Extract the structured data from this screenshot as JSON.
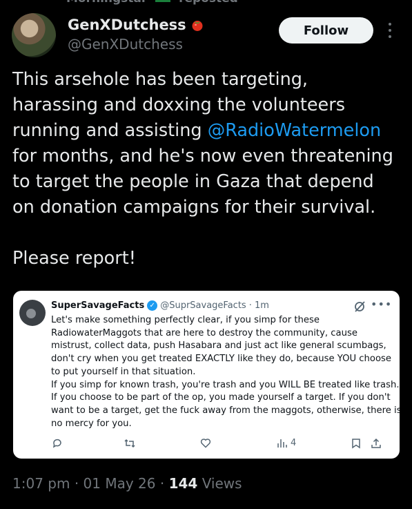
{
  "top_cut": {
    "name": "Morningstar",
    "status": "reposted"
  },
  "author": {
    "display_name": "GenXDutchess",
    "handle": "@GenXDutchess",
    "badge": "tomato-emoji"
  },
  "follow_label": "Follow",
  "post": {
    "line1": "This arsehole has been targeting,",
    "line2": "harassing and doxxing the volunteers",
    "line3_pre": "running and assisting ",
    "line3_mention": "@RadioWatermelon",
    "line4": "for months, and he's now even threatening",
    "line5": "to target the people in Gaza that depend",
    "line6": "on  donation campaigns for their survival.",
    "line7": "Please report!"
  },
  "quote": {
    "display_name": "SuperSavageFacts",
    "handle": "@SuprSavageFacts",
    "time": "· 1m",
    "lines": [
      "Let's make something perfectly clear, if you simp for these",
      "RadiowaterMaggots that are here to destroy the community, cause",
      "mistrust, collect data, push Hasabara and just act like general scumbags,",
      "don't cry when you get treated EXACTLY like they do, because YOU choose",
      "to put yourself in that situation.",
      "If you simp for known trash, you're trash and you WILL BE treated like trash.",
      "If you choose to be part of the op, you made yourself a target. If you don't",
      "want to be a target, get the fuck away from the maggots, otherwise, there is",
      "no mercy for you."
    ],
    "views_count": "4"
  },
  "meta": {
    "time": "1:07 pm",
    "date": "01 May 26",
    "views_count": "144",
    "views_label": "Views",
    "sep": "·"
  },
  "colors": {
    "background": "#000000",
    "mention": "#1d9bf0",
    "secondary": "#71767b",
    "verified": "#1d9bf0"
  }
}
